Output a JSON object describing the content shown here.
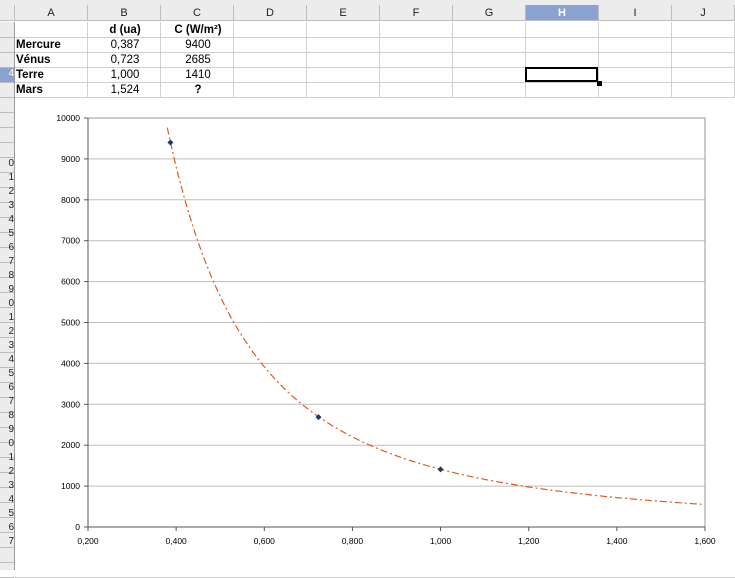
{
  "columns": [
    "A",
    "B",
    "C",
    "D",
    "E",
    "F",
    "G",
    "H",
    "I",
    "J"
  ],
  "active_column": "H",
  "active_row_label": "4",
  "row_labels": [
    "0",
    "1",
    "2",
    "3",
    "4",
    "5",
    "6",
    "7",
    "8",
    "9",
    "0",
    "1",
    "2",
    "3",
    "4",
    "5",
    "6",
    "7",
    "8",
    "9",
    "0",
    "1",
    "2",
    "3",
    "4",
    "5",
    "6",
    "7"
  ],
  "table": {
    "headers": [
      "",
      "d (ua)",
      "C (W/m²)"
    ],
    "rows": [
      {
        "name": "Mercure",
        "d": "0,387",
        "c": "9400"
      },
      {
        "name": "Vénus",
        "d": "0,723",
        "c": "2685"
      },
      {
        "name": "Terre",
        "d": "1,000",
        "c": "1410"
      },
      {
        "name": "Mars",
        "d": "1,524",
        "c": "?"
      }
    ]
  },
  "chart_data": {
    "type": "scatter",
    "x": [
      0.387,
      0.723,
      1.0
    ],
    "y": [
      9400,
      2685,
      1410
    ],
    "trendline": {
      "type": "power",
      "formula": "y = 1410 / x^2"
    },
    "xlim": [
      0.2,
      1.6
    ],
    "ylim": [
      0,
      10000
    ],
    "xticks": [
      "0,200",
      "0,400",
      "0,600",
      "0,800",
      "1,000",
      "1,200",
      "1,400",
      "1,600"
    ],
    "yticks": [
      "0",
      "1000",
      "2000",
      "3000",
      "4000",
      "5000",
      "6000",
      "7000",
      "8000",
      "9000",
      "10000"
    ],
    "grid": true,
    "colors": {
      "points": "#1f3a5f",
      "trendline": "#e05a20",
      "grid": "#bdbdbd"
    }
  }
}
